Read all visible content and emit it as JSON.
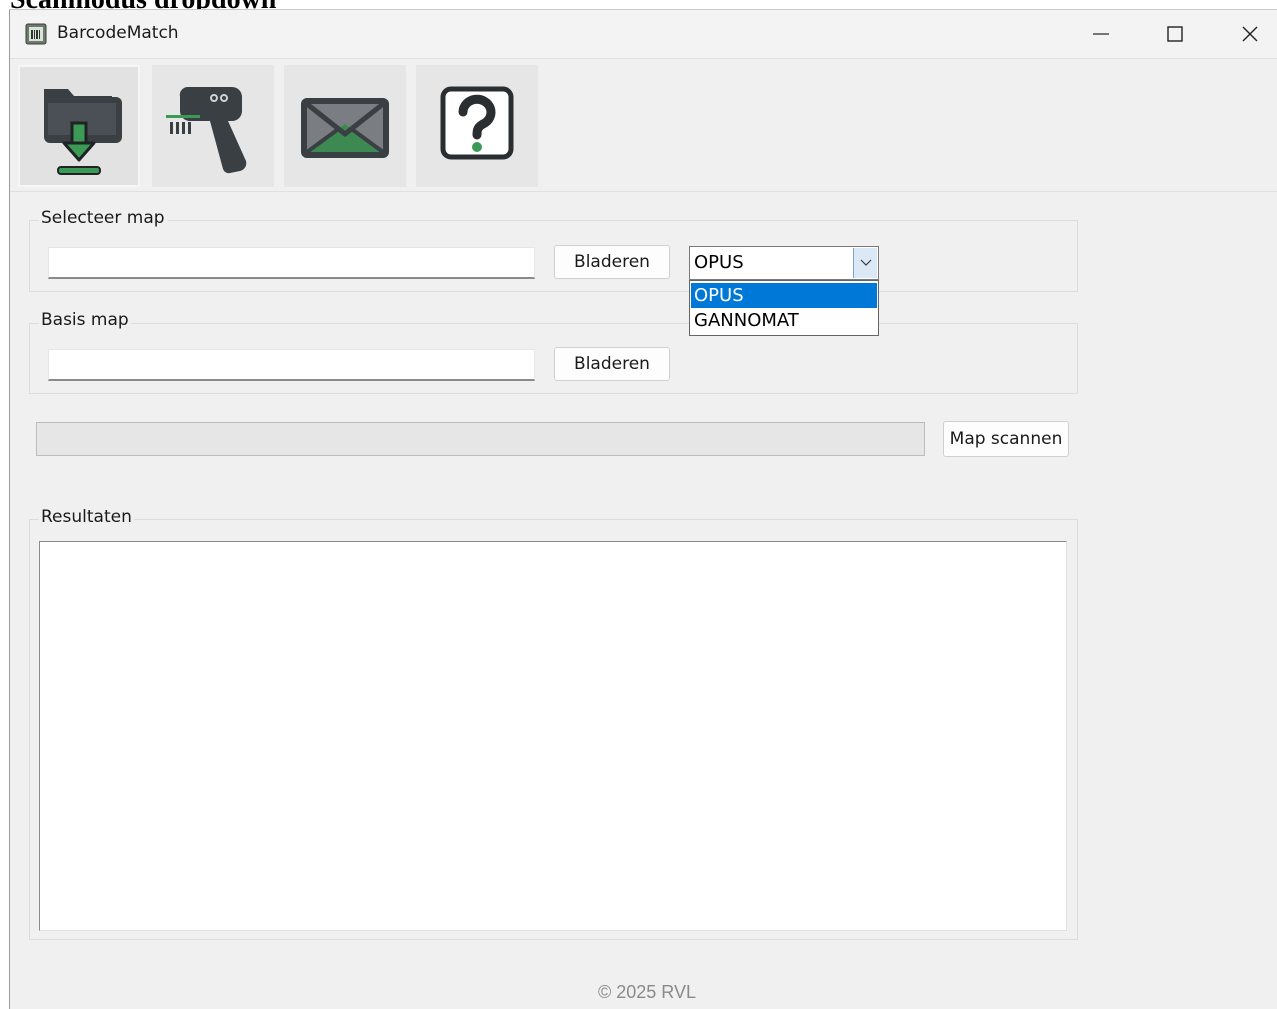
{
  "doc_heading": "Scanmodus dropdown",
  "window": {
    "title": "BarcodeMatch",
    "controls": [
      "minimize-icon",
      "maximize-icon",
      "close-icon"
    ]
  },
  "toolbar": {
    "tools": [
      {
        "name": "folder-download",
        "icon": "folder-download-icon",
        "active": true
      },
      {
        "name": "barcode-scanner",
        "icon": "barcode-scanner-icon",
        "active": false
      },
      {
        "name": "mail",
        "icon": "envelope-icon",
        "active": false
      },
      {
        "name": "help",
        "icon": "question-mark-icon",
        "active": false
      }
    ]
  },
  "select_map": {
    "label": "Selecteer map",
    "input_value": "",
    "browse_label": "Bladeren",
    "mode": {
      "value": "OPUS",
      "options": [
        "OPUS",
        "GANNOMAT"
      ],
      "selected_index": 0
    }
  },
  "base_map": {
    "label": "Basis map",
    "input_value": "",
    "browse_label": "Bladeren"
  },
  "scan": {
    "progress": 0,
    "button_label": "Map scannen"
  },
  "results": {
    "label": "Resultaten",
    "content": ""
  },
  "footer": "© 2025 RVL",
  "colors": {
    "accent": "#0078d7",
    "icon_dark": "#3a3f44",
    "icon_green": "#3c9a57"
  }
}
